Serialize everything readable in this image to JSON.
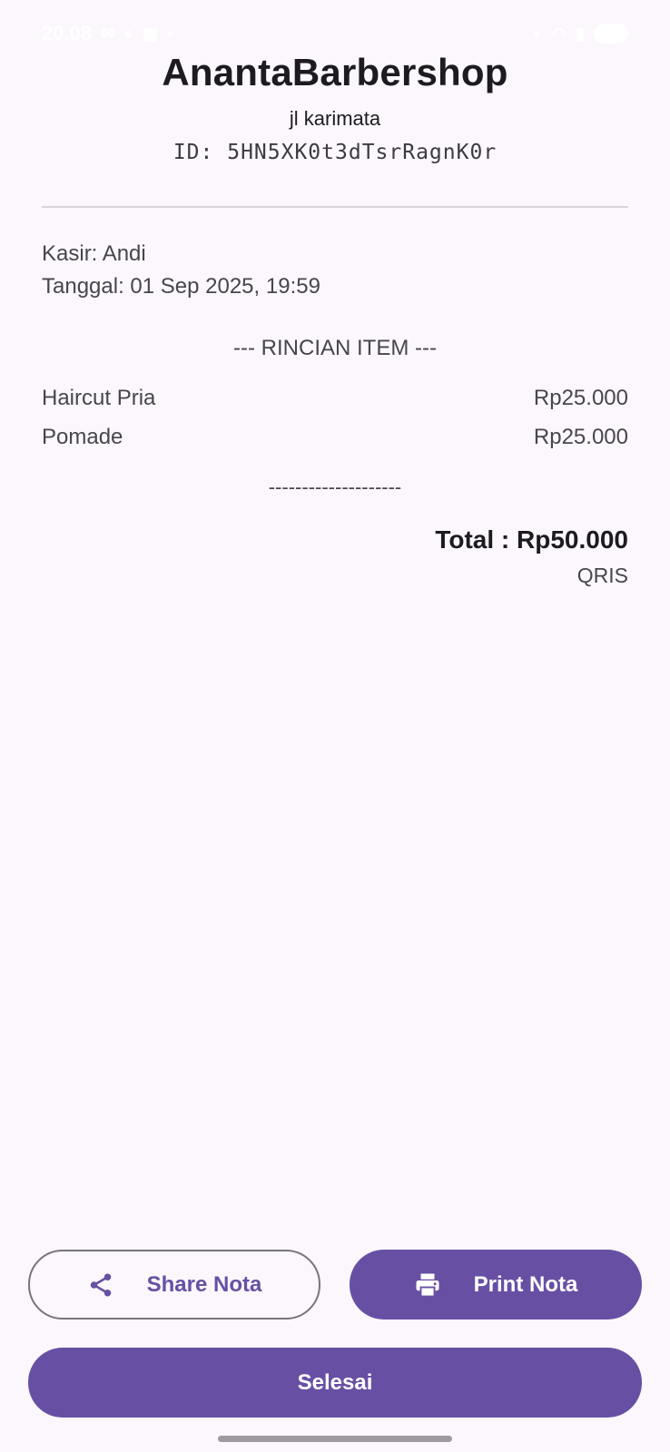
{
  "status_bar": {
    "time": "20.08"
  },
  "receipt": {
    "shop_name": "AnantaBarbershop",
    "address": "jl karimata",
    "id_line": "ID: 5HN5XK0t3dTsrRagnK0r",
    "cashier": "Kasir: Andi",
    "date": "Tanggal: 01 Sep 2025, 19:59",
    "section_title": "--- RINCIAN ITEM ---",
    "items": [
      {
        "name": "Haircut Pria",
        "price": "Rp25.000"
      },
      {
        "name": "Pomade",
        "price": "Rp25.000"
      }
    ],
    "separator": "--------------------",
    "total": "Total : Rp50.000",
    "payment_method": "QRIS"
  },
  "actions": {
    "share_label": "Share Nota",
    "print_label": "Print Nota",
    "done_label": "Selesai"
  },
  "icons": {
    "share": "share-icon",
    "print": "printer-icon"
  },
  "colors": {
    "background": "#fcf7fc",
    "primary": "#6750a4",
    "outline": "#79747e",
    "text": "#1d1b20"
  }
}
